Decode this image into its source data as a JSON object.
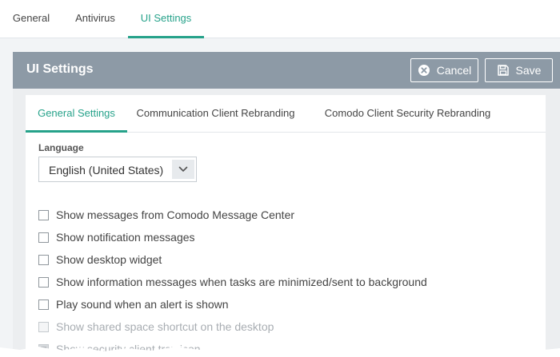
{
  "top_tabs": [
    {
      "label": "General"
    },
    {
      "label": "Antivirus"
    },
    {
      "label": "UI Settings"
    }
  ],
  "panel": {
    "title": "UI Settings",
    "cancel_label": "Cancel",
    "save_label": "Save"
  },
  "sub_tabs": [
    {
      "label": "General Settings"
    },
    {
      "label": "Communication Client Rebranding"
    },
    {
      "label": "Comodo Client Security Rebranding"
    }
  ],
  "language": {
    "label": "Language",
    "value": "English (United States)"
  },
  "options": [
    {
      "label": "Show messages from Comodo Message Center",
      "checked": false,
      "disabled": false
    },
    {
      "label": "Show notification messages",
      "checked": false,
      "disabled": false
    },
    {
      "label": "Show desktop widget",
      "checked": false,
      "disabled": false
    },
    {
      "label": "Show information messages when tasks are minimized/sent to background",
      "checked": false,
      "disabled": false
    },
    {
      "label": "Play sound when an alert is shown",
      "checked": false,
      "disabled": false
    },
    {
      "label": "Show shared space shortcut on the desktop",
      "checked": false,
      "disabled": true
    },
    {
      "label": "Show security client tray icon",
      "checked": true,
      "disabled": true
    }
  ],
  "colors": {
    "accent": "#26a28a",
    "header_bg": "#8d9aa6"
  }
}
